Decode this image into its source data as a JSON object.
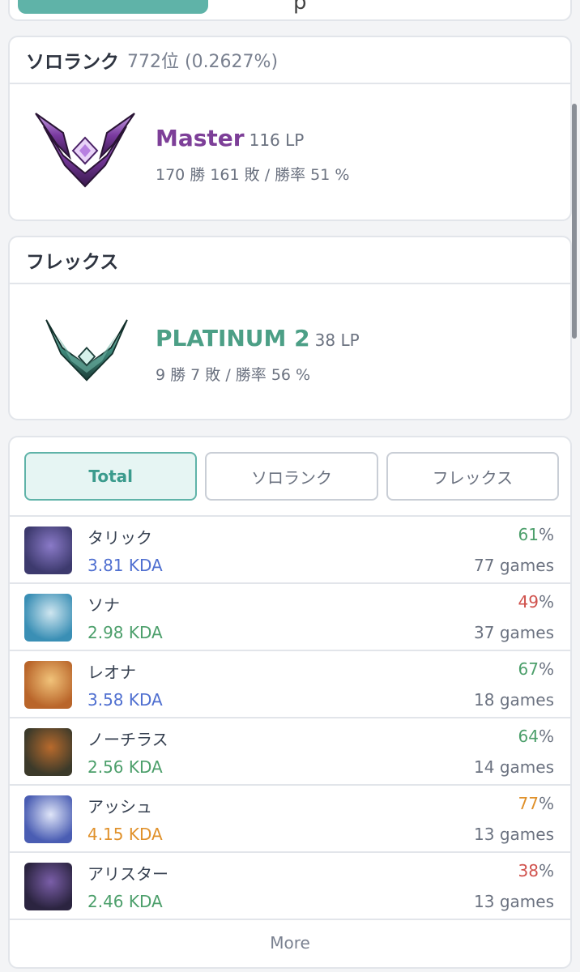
{
  "top_tabs": {
    "partial_text": "p"
  },
  "solo_rank": {
    "title": "ソロランク",
    "position": "772位 (0.2627%)",
    "tier": "Master",
    "lp": "116 LP",
    "record": "170 勝 161 敗 / 勝率 51 %",
    "tier_color": "#7d3f98",
    "emblem": "master-emblem-icon"
  },
  "flex_rank": {
    "title": "フレックス",
    "tier": "PLATINUM 2",
    "lp": "38 LP",
    "record": "9 勝 7 敗 / 勝率 56 %",
    "tier_color": "#4c9f86",
    "emblem": "platinum-emblem-icon"
  },
  "champion_tabs": [
    "Total",
    "ソロランク",
    "フレックス"
  ],
  "active_tab": "Total",
  "champions": [
    {
      "name": "タリック",
      "kda": "3.81 KDA",
      "kda_color": "#4f6fd0",
      "winrate": "61",
      "wr_color": "#4c9f6b",
      "games": "77 games",
      "portrait": [
        "#3d3a6e",
        "#8a7ac8"
      ]
    },
    {
      "name": "ソナ",
      "kda": "2.98 KDA",
      "kda_color": "#4c9f6b",
      "winrate": "49",
      "wr_color": "#d0524d",
      "games": "37 games",
      "portrait": [
        "#3a8fb5",
        "#cfe6f0"
      ]
    },
    {
      "name": "レオナ",
      "kda": "3.58 KDA",
      "kda_color": "#4f6fd0",
      "winrate": "67",
      "wr_color": "#4c9f6b",
      "games": "18 games",
      "portrait": [
        "#b9652a",
        "#f1c37a"
      ]
    },
    {
      "name": "ノーチラス",
      "kda": "2.56 KDA",
      "kda_color": "#4c9f6b",
      "winrate": "64",
      "wr_color": "#4c9f6b",
      "games": "14 games",
      "portrait": [
        "#3c3a2a",
        "#b86a2c"
      ]
    },
    {
      "name": "アッシュ",
      "kda": "4.15 KDA",
      "kda_color": "#e0912b",
      "winrate": "77",
      "wr_color": "#e0912b",
      "games": "13 games",
      "portrait": [
        "#4a5db3",
        "#dfe5f8"
      ]
    },
    {
      "name": "アリスター",
      "kda": "2.46 KDA",
      "kda_color": "#4c9f6b",
      "winrate": "38",
      "wr_color": "#d0524d",
      "games": "13 games",
      "portrait": [
        "#2b2440",
        "#7a5ea8"
      ]
    }
  ],
  "pct_sign": "%",
  "more_label": "More"
}
